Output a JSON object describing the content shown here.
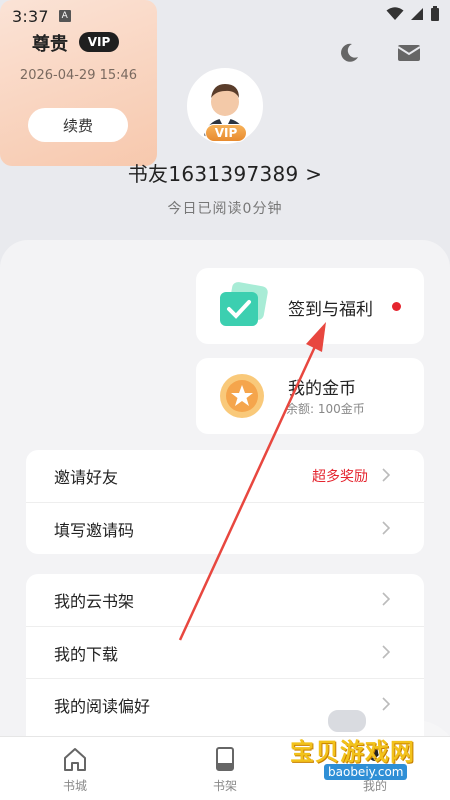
{
  "status_bar": {
    "time": "3:37",
    "a_label": "A"
  },
  "profile": {
    "username": "书友1631397389 >",
    "reading": "今日已阅读0分钟",
    "vip_badge": "VIP"
  },
  "vip_card": {
    "title": "尊贵",
    "pill": "VIP",
    "date": "2026-04-29 15:46",
    "renew": "续费"
  },
  "sign_card": {
    "label": "签到与福利"
  },
  "coin_card": {
    "label": "我的金币",
    "sub": "余额: 100金币"
  },
  "list1": [
    {
      "label": "邀请好友",
      "tag": "超多奖励"
    },
    {
      "label": "填写邀请码",
      "tag": ""
    }
  ],
  "list2": [
    {
      "label": "我的云书架"
    },
    {
      "label": "我的下载"
    },
    {
      "label": "我的阅读偏好"
    }
  ],
  "tabs": [
    {
      "label": "书城",
      "icon": "home-icon"
    },
    {
      "label": "书架",
      "icon": "book-icon"
    },
    {
      "label": "我的",
      "icon": "person-icon"
    }
  ],
  "watermark": {
    "title": "宝贝游戏网",
    "url": "baobeiy.com"
  },
  "colors": {
    "accent_red": "#e5252f",
    "vip_gold": "#e88b2f"
  }
}
